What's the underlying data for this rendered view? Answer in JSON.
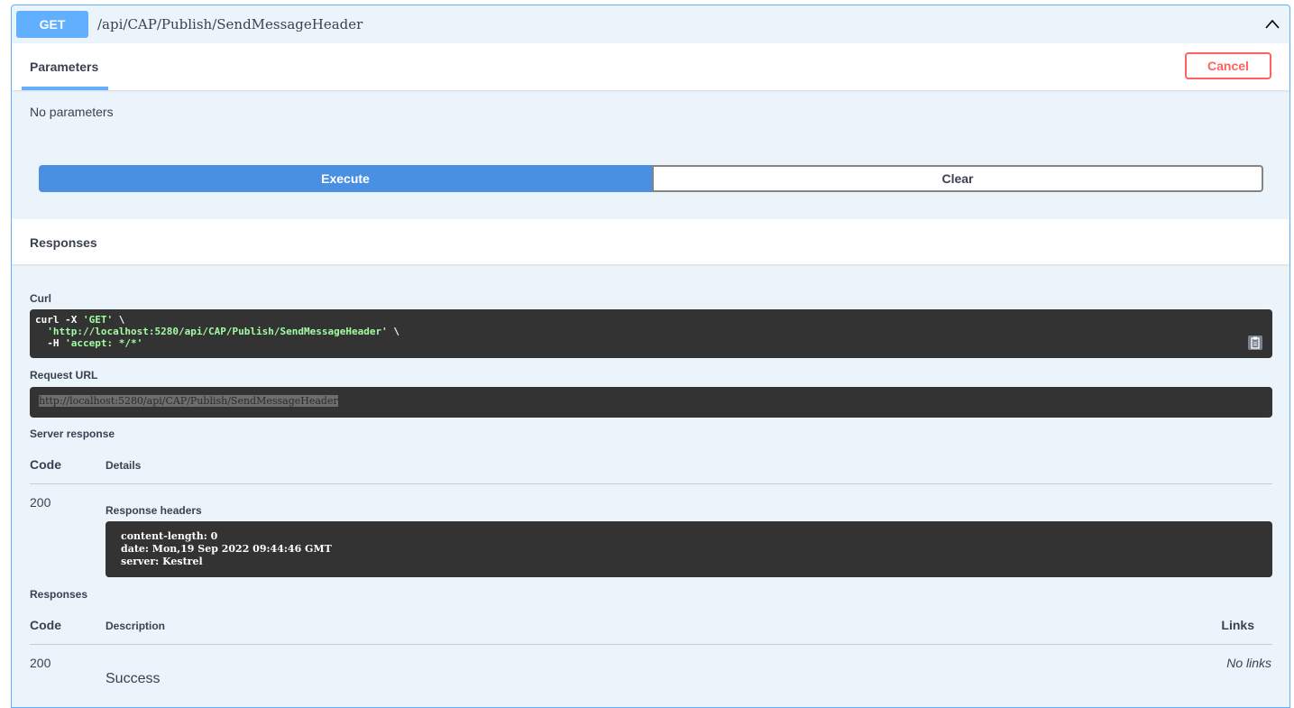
{
  "operation": {
    "method": "GET",
    "path": "/api/CAP/Publish/SendMessageHeader",
    "method_color": "#61affe"
  },
  "parameters": {
    "tab_label": "Parameters",
    "cancel_label": "Cancel",
    "empty_text": "No parameters"
  },
  "actions": {
    "execute_label": "Execute",
    "clear_label": "Clear"
  },
  "responses_section": {
    "title": "Responses",
    "curl_label": "Curl",
    "curl_lines": [
      {
        "plain": "curl -X ",
        "str": "'GET'",
        "tail": " \\"
      },
      {
        "plain": "  ",
        "str": "'http://localhost:5280/api/CAP/Publish/SendMessageHeader'",
        "tail": " \\"
      },
      {
        "plain": "  -H ",
        "str": "'accept: */*'",
        "tail": ""
      }
    ],
    "request_url_label": "Request URL",
    "request_url": "http://localhost:5280/api/CAP/Publish/SendMessageHeader",
    "server_response_label": "Server response",
    "code_header": "Code",
    "details_header": "Details",
    "server_code": "200",
    "response_headers_label": "Response headers",
    "response_headers": [
      "content-length: 0",
      "date: Mon,19 Sep 2022 09:44:46 GMT",
      "server: Kestrel"
    ],
    "documented_label": "Responses",
    "documented_code_header": "Code",
    "description_header": "Description",
    "links_header": "Links",
    "documented_code": "200",
    "documented_description": "Success",
    "documented_links": "No links"
  }
}
